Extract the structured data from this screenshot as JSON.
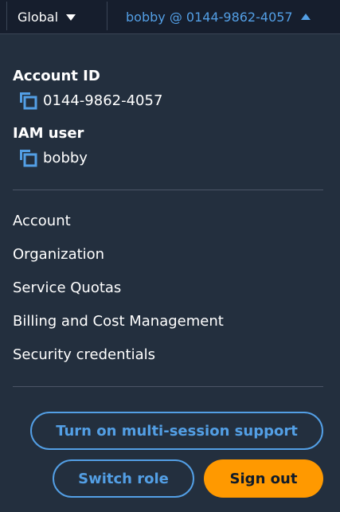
{
  "header": {
    "region_label": "Global",
    "account_label": "bobby @ 0144-9862-4057"
  },
  "account": {
    "id_label": "Account ID",
    "id_value": "0144-9862-4057",
    "user_label": "IAM user",
    "user_value": "bobby"
  },
  "menu": {
    "items": [
      {
        "label": "Account"
      },
      {
        "label": "Organization"
      },
      {
        "label": "Service Quotas"
      },
      {
        "label": "Billing and Cost Management"
      },
      {
        "label": "Security credentials"
      }
    ]
  },
  "actions": {
    "multi_session_label": "Turn on multi-session support",
    "switch_role_label": "Switch role",
    "sign_out_label": "Sign out"
  },
  "colors": {
    "accent": "#539fe5",
    "primary": "#ff9900",
    "background": "#232f3e",
    "header_background": "#161e2d"
  },
  "icons": {
    "region_caret": "caret-down-icon",
    "account_caret": "caret-up-icon",
    "copy": "copy-icon"
  }
}
